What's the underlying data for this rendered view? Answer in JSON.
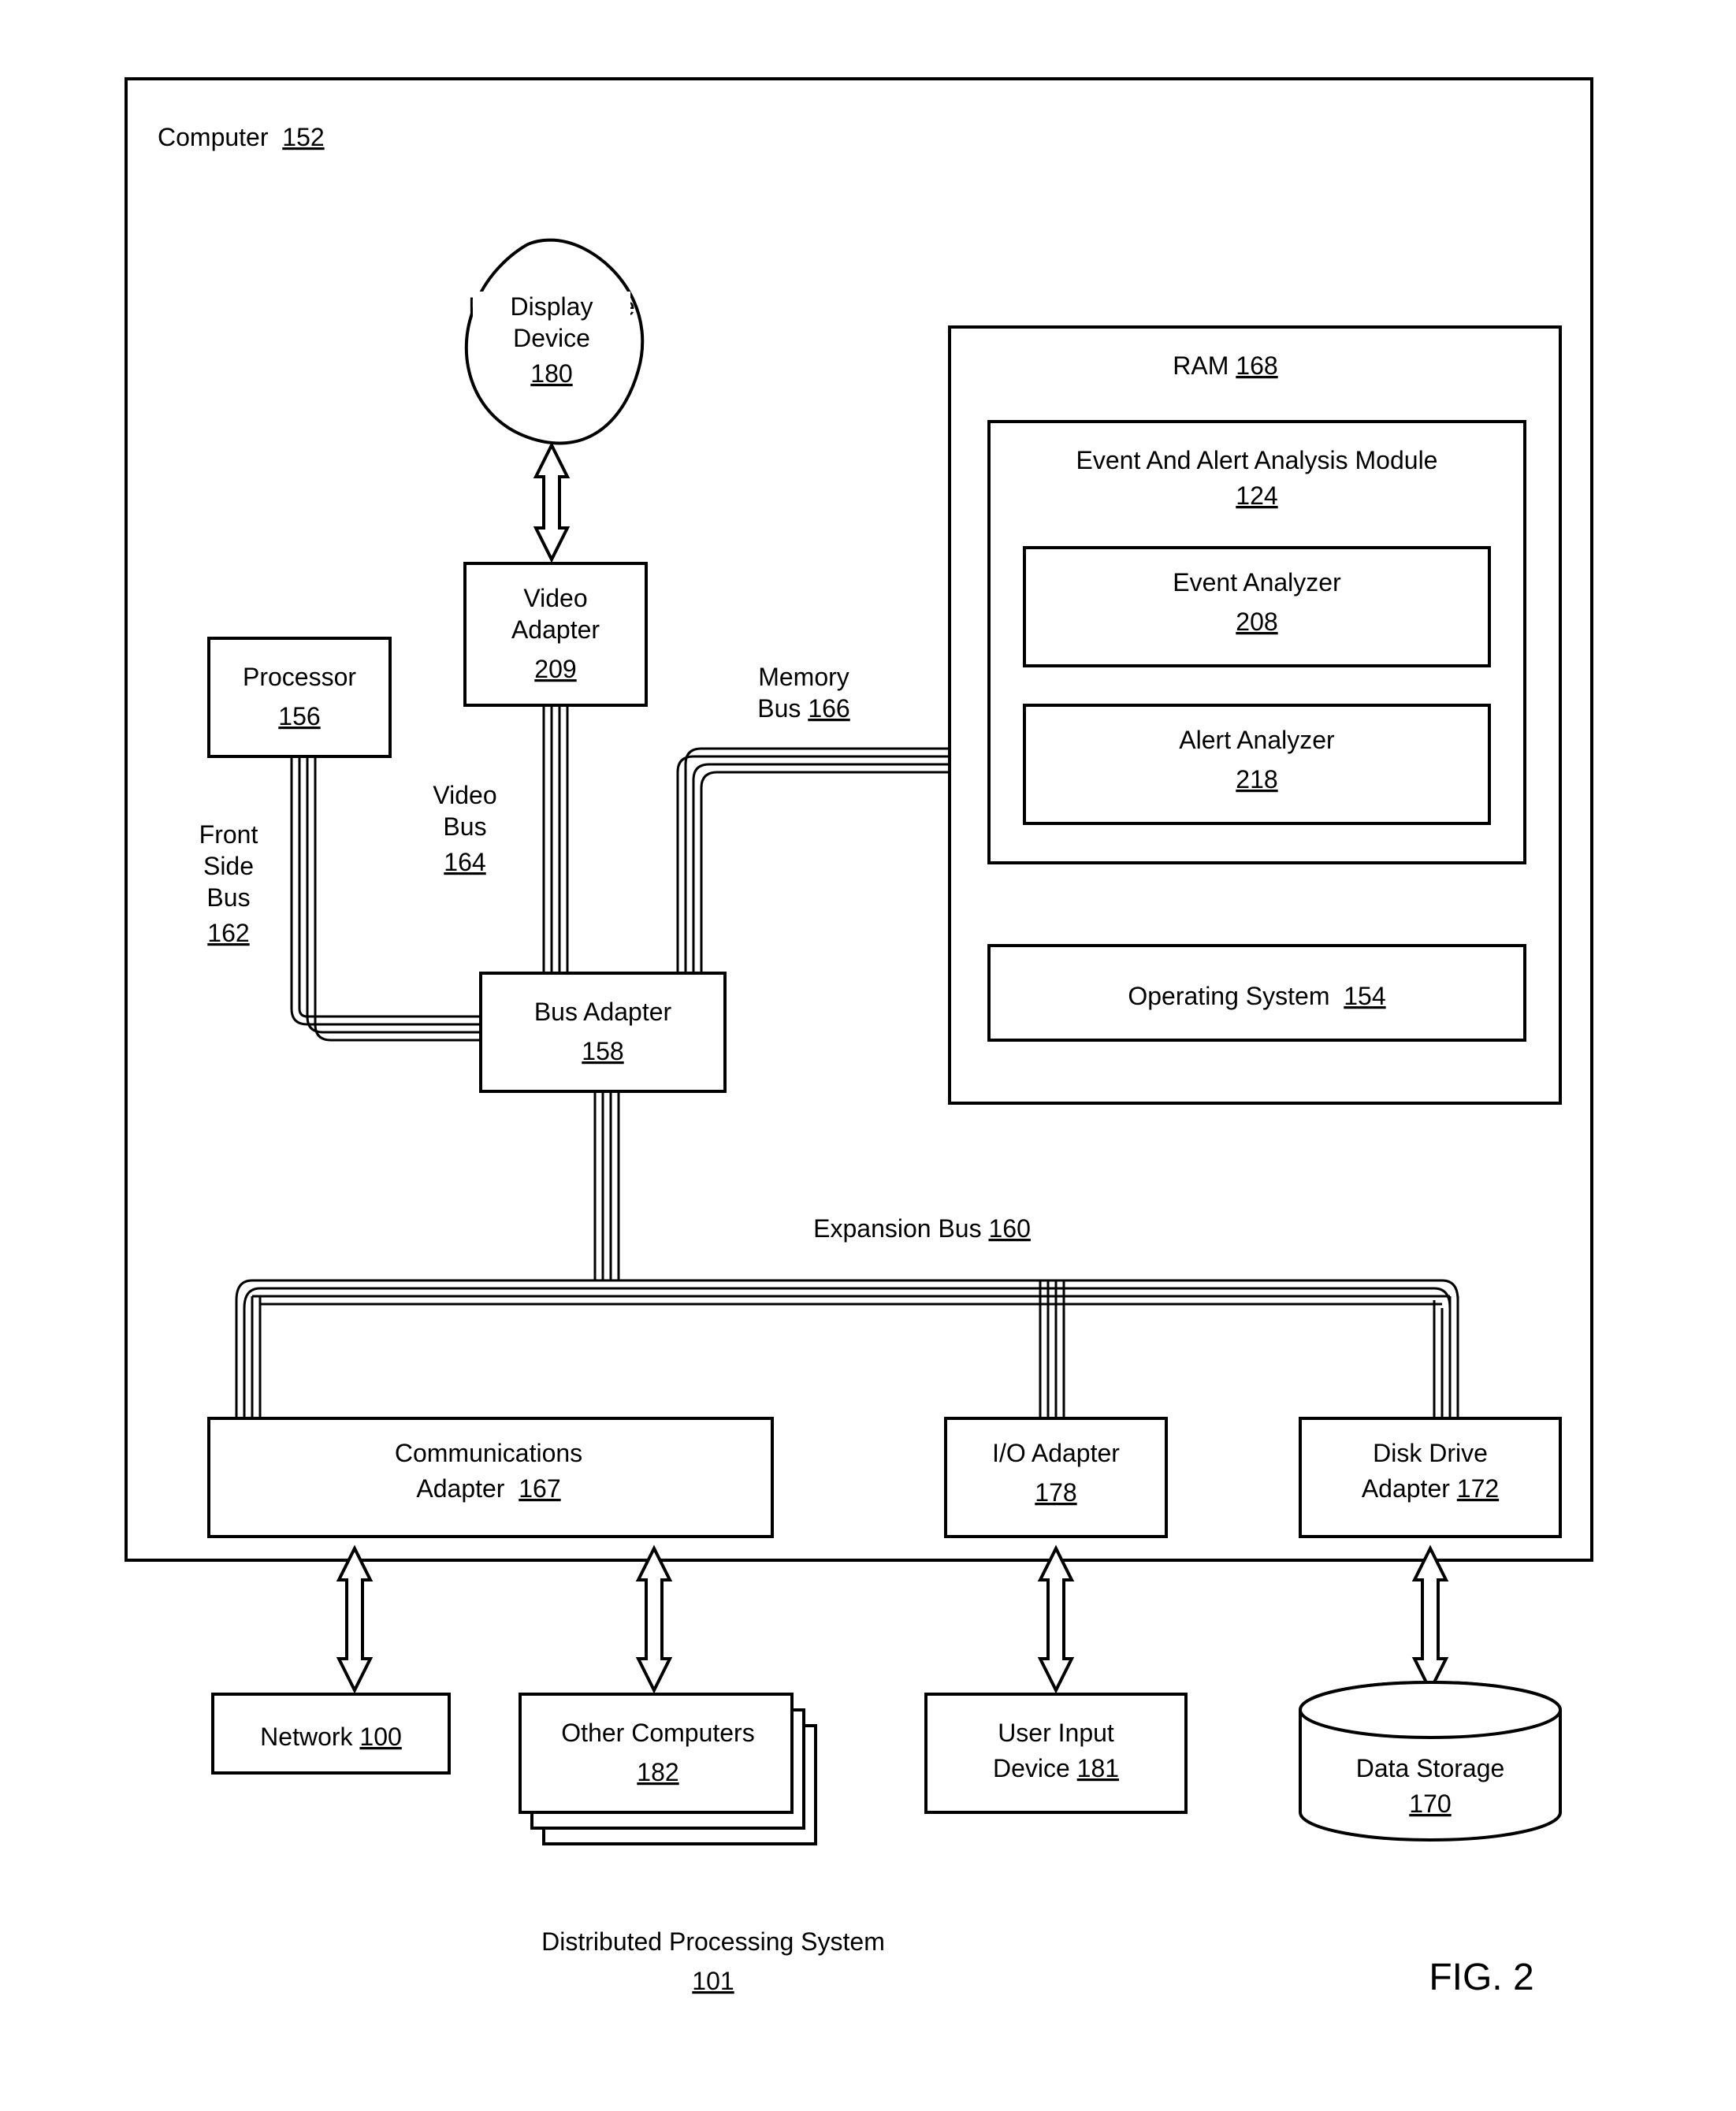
{
  "title": "Computer",
  "title_num": "152",
  "figure": "FIG. 2",
  "footer_label": "Distributed Processing System",
  "footer_num": "101",
  "blocks": {
    "display": {
      "label": "Display Device",
      "num": "180"
    },
    "video": {
      "label": "Video Adapter",
      "num": "209"
    },
    "processor": {
      "label": "Processor",
      "num": "156"
    },
    "busadapter": {
      "label": "Bus Adapter",
      "num": "158"
    },
    "ram": {
      "label": "RAM",
      "num": "168"
    },
    "eamodule": {
      "label": "Event And Alert Analysis Module",
      "num": "124"
    },
    "eventan": {
      "label": "Event Analyzer",
      "num": "208"
    },
    "alertan": {
      "label": "Alert Analyzer",
      "num": "218"
    },
    "os": {
      "label": "Operating System",
      "num": "154"
    },
    "comm": {
      "label": "Communications Adapter",
      "num": "167"
    },
    "io": {
      "label": "I/O Adapter",
      "num": "178"
    },
    "disk": {
      "label": "Disk Drive Adapter",
      "num": "172"
    },
    "net": {
      "label": "Network",
      "num": "100"
    },
    "other": {
      "label": "Other Computers",
      "num": "182"
    },
    "uid": {
      "label": "User Input Device",
      "num": "181"
    },
    "storage": {
      "label": "Data Storage",
      "num": "170"
    }
  },
  "buses": {
    "videobus": {
      "label": "Video Bus",
      "num": "164"
    },
    "frontside": {
      "label": "Front Side Bus",
      "num": "162"
    },
    "memory": {
      "label": "Memory Bus",
      "num": "166"
    },
    "expansion": {
      "label": "Expansion Bus",
      "num": "160"
    }
  }
}
